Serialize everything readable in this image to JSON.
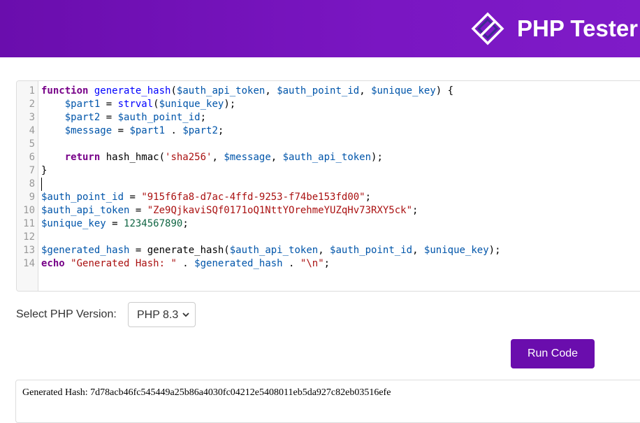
{
  "header": {
    "title": "PHP Tester",
    "logo_icon": "diamond-code-icon",
    "background": "#6a0dad"
  },
  "editor": {
    "lines": [
      {
        "num": "1",
        "tokens": [
          {
            "t": "function",
            "c": "kw"
          },
          {
            "t": " generate_hash",
            "c": "def"
          },
          {
            "t": "(",
            "c": "fn"
          },
          {
            "t": "$auth_api_token",
            "c": "var"
          },
          {
            "t": ", ",
            "c": "fn"
          },
          {
            "t": "$auth_point_id",
            "c": "var"
          },
          {
            "t": ", ",
            "c": "fn"
          },
          {
            "t": "$unique_key",
            "c": "var"
          },
          {
            "t": ") {",
            "c": "fn"
          }
        ]
      },
      {
        "num": "2",
        "tokens": [
          {
            "t": "    ",
            "c": "fn"
          },
          {
            "t": "$part1",
            "c": "var"
          },
          {
            "t": " = ",
            "c": "fn"
          },
          {
            "t": "strval",
            "c": "def"
          },
          {
            "t": "(",
            "c": "fn"
          },
          {
            "t": "$unique_key",
            "c": "var"
          },
          {
            "t": ");",
            "c": "fn"
          }
        ]
      },
      {
        "num": "3",
        "tokens": [
          {
            "t": "    ",
            "c": "fn"
          },
          {
            "t": "$part2",
            "c": "var"
          },
          {
            "t": " = ",
            "c": "fn"
          },
          {
            "t": "$auth_point_id",
            "c": "var"
          },
          {
            "t": ";",
            "c": "fn"
          }
        ]
      },
      {
        "num": "4",
        "tokens": [
          {
            "t": "    ",
            "c": "fn"
          },
          {
            "t": "$message",
            "c": "var"
          },
          {
            "t": " = ",
            "c": "fn"
          },
          {
            "t": "$part1",
            "c": "var"
          },
          {
            "t": " . ",
            "c": "fn"
          },
          {
            "t": "$part2",
            "c": "var"
          },
          {
            "t": ";",
            "c": "fn"
          }
        ]
      },
      {
        "num": "5",
        "tokens": []
      },
      {
        "num": "6",
        "tokens": [
          {
            "t": "    ",
            "c": "fn"
          },
          {
            "t": "return",
            "c": "kw"
          },
          {
            "t": " hash_hmac(",
            "c": "fn"
          },
          {
            "t": "'sha256'",
            "c": "str"
          },
          {
            "t": ", ",
            "c": "fn"
          },
          {
            "t": "$message",
            "c": "var"
          },
          {
            "t": ", ",
            "c": "fn"
          },
          {
            "t": "$auth_api_token",
            "c": "var"
          },
          {
            "t": ");",
            "c": "fn"
          }
        ]
      },
      {
        "num": "7",
        "tokens": [
          {
            "t": "}",
            "c": "fn"
          }
        ]
      },
      {
        "num": "8",
        "tokens": []
      },
      {
        "num": "9",
        "tokens": [
          {
            "t": "$auth_point_id",
            "c": "var"
          },
          {
            "t": " = ",
            "c": "fn"
          },
          {
            "t": "\"915f6fa8-d7ac-4ffd-9253-f74be153fd00\"",
            "c": "str"
          },
          {
            "t": ";",
            "c": "fn"
          }
        ]
      },
      {
        "num": "10",
        "tokens": [
          {
            "t": "$auth_api_token",
            "c": "var"
          },
          {
            "t": " = ",
            "c": "fn"
          },
          {
            "t": "\"Ze9QjkaviSQf0171oQ1NttYOrehmeYUZqHv73RXY5ck\"",
            "c": "str"
          },
          {
            "t": ";",
            "c": "fn"
          }
        ]
      },
      {
        "num": "11",
        "tokens": [
          {
            "t": "$unique_key",
            "c": "var"
          },
          {
            "t": " = ",
            "c": "fn"
          },
          {
            "t": "1234567890",
            "c": "num"
          },
          {
            "t": ";",
            "c": "fn"
          }
        ]
      },
      {
        "num": "12",
        "tokens": []
      },
      {
        "num": "13",
        "tokens": [
          {
            "t": "$generated_hash",
            "c": "var"
          },
          {
            "t": " = ",
            "c": "fn"
          },
          {
            "t": "generate_hash(",
            "c": "fn"
          },
          {
            "t": "$auth_api_token",
            "c": "var"
          },
          {
            "t": ", ",
            "c": "fn"
          },
          {
            "t": "$auth_point_id",
            "c": "var"
          },
          {
            "t": ", ",
            "c": "fn"
          },
          {
            "t": "$unique_key",
            "c": "var"
          },
          {
            "t": ");",
            "c": "fn"
          }
        ]
      },
      {
        "num": "14",
        "tokens": [
          {
            "t": "echo",
            "c": "kw"
          },
          {
            "t": " ",
            "c": "fn"
          },
          {
            "t": "\"Generated Hash: \"",
            "c": "str"
          },
          {
            "t": " . ",
            "c": "fn"
          },
          {
            "t": "$generated_hash",
            "c": "var"
          },
          {
            "t": " . ",
            "c": "fn"
          },
          {
            "t": "\"\\n\"",
            "c": "str"
          },
          {
            "t": ";",
            "c": "fn"
          }
        ]
      }
    ],
    "cursor_line": 8
  },
  "controls": {
    "version_label": "Select PHP Version:",
    "version_selected": "PHP 8.3",
    "chevron_icon": "chevron-down-icon",
    "run_label": "Run Code"
  },
  "output": {
    "text": "Generated Hash: 7d78acb46fc545449a25b86a4030fc04212e5408011eb5da927c82eb03516efe"
  }
}
